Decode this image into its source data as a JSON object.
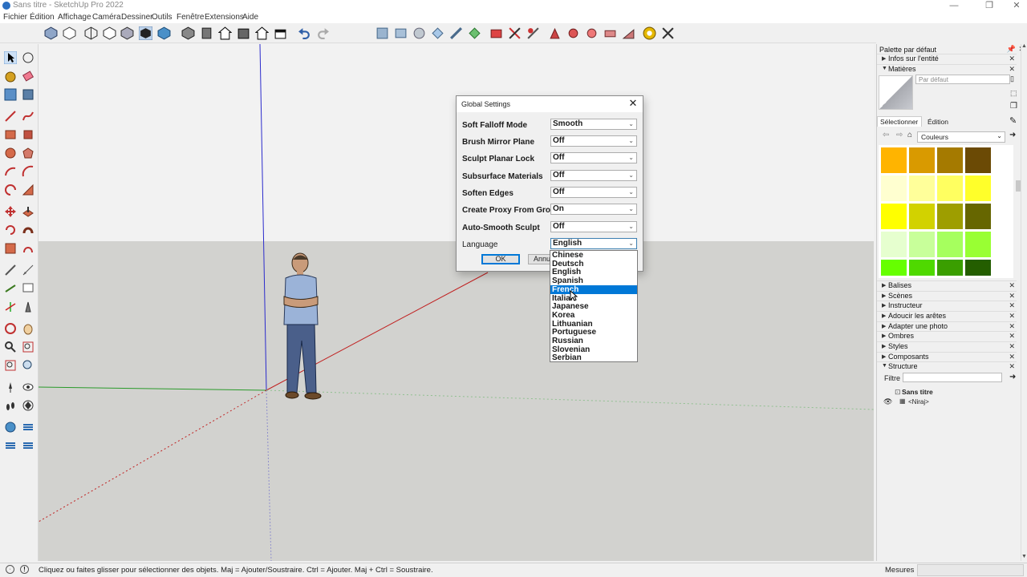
{
  "titlebar": {
    "title": "Sans titre - SketchUp Pro 2022",
    "minimize": "—",
    "maximize": "❐",
    "close": "✕"
  },
  "menubar": [
    "Fichier",
    "Édition",
    "Affichage",
    "Caméra",
    "Dessiner",
    "Outils",
    "Fenêtre",
    "Extensions",
    "Aide"
  ],
  "dialog": {
    "title": "Global Settings",
    "close": "✕",
    "rows": [
      {
        "label": "Soft Falloff Mode",
        "value": "Smooth"
      },
      {
        "label": "Brush Mirror Plane",
        "value": "Off"
      },
      {
        "label": "Sculpt Planar Lock",
        "value": "Off"
      },
      {
        "label": "Subsurface Materials",
        "value": "Off"
      },
      {
        "label": "Soften Edges",
        "value": "Off"
      },
      {
        "label": "Create Proxy From Group",
        "value": "On"
      },
      {
        "label": "Auto-Smooth Sculpt",
        "value": "Off"
      },
      {
        "label": "Language",
        "value": "English"
      }
    ],
    "ok_label": "OK",
    "cancel_label": "Annul"
  },
  "language_dropdown": {
    "options": [
      "Chinese",
      "Deutsch",
      "English",
      "Spanish",
      "French",
      "Italian",
      "Japanese",
      "Korea",
      "Lithuanian",
      "Portuguese",
      "Russian",
      "Slovenian",
      "Serbian"
    ],
    "highlighted": "French"
  },
  "tray": {
    "title": "Palette par défaut",
    "sections_top": [
      {
        "label": "Infos sur l'entité",
        "expanded": false
      },
      {
        "label": "Matières",
        "expanded": true
      }
    ],
    "material_name": "Par défaut",
    "tabs": [
      "Sélectionner",
      "Édition"
    ],
    "library": "Couleurs",
    "sections_bottom": [
      {
        "label": "Balises",
        "expanded": false
      },
      {
        "label": "Scènes",
        "expanded": false
      },
      {
        "label": "Instructeur",
        "expanded": false
      },
      {
        "label": "Adoucir les arêtes",
        "expanded": false
      },
      {
        "label": "Adapter une photo",
        "expanded": false
      },
      {
        "label": "Ombres",
        "expanded": false
      },
      {
        "label": "Styles",
        "expanded": false
      },
      {
        "label": "Composants",
        "expanded": false
      },
      {
        "label": "Structure",
        "expanded": true
      }
    ],
    "filter_label": "Filtre :",
    "outliner_root": "Sans titre",
    "outliner_child": "<Niraj>",
    "swatches": [
      "#ffb400",
      "#d99a00",
      "#a57a00",
      "#6b4a05",
      "#ffffd0",
      "#ffff9a",
      "#ffff60",
      "#ffff2a",
      "#ffff00",
      "#d2d200",
      "#9e9e00",
      "#666600",
      "#e6ffcf",
      "#c8ff9a",
      "#a6ff5e",
      "#99ff33",
      "#66ff00",
      "#4fd900",
      "#3a9e00",
      "#245e00"
    ]
  },
  "status": {
    "hint": "Cliquez ou faites glisser pour sélectionner des objets. Maj = Ajouter/Soustraire. Ctrl = Ajouter. Maj + Ctrl = Soustraire.",
    "measure_label": "Mesures"
  }
}
